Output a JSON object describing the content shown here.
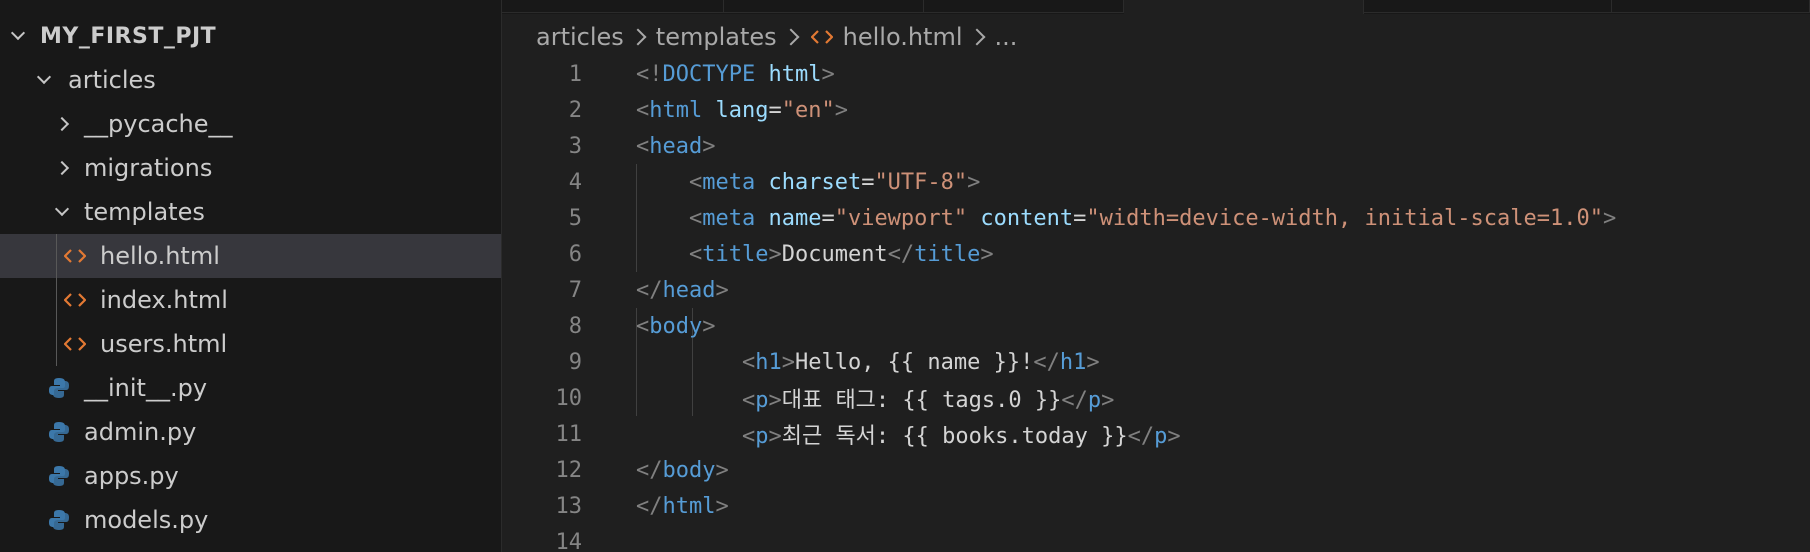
{
  "explorer": {
    "root": "MY_FIRST_PJT",
    "items": [
      {
        "label": "articles",
        "icon": "chevron-down-icon"
      },
      {
        "label": "__pycache__",
        "icon": "chevron-right-icon"
      },
      {
        "label": "migrations",
        "icon": "chevron-right-icon"
      },
      {
        "label": "templates",
        "icon": "chevron-down-icon"
      },
      {
        "label": "hello.html",
        "icon": "html-file-icon",
        "selected": true
      },
      {
        "label": "index.html",
        "icon": "html-file-icon"
      },
      {
        "label": "users.html",
        "icon": "html-file-icon"
      },
      {
        "label": "__init__.py",
        "icon": "python-file-icon"
      },
      {
        "label": "admin.py",
        "icon": "python-file-icon"
      },
      {
        "label": "apps.py",
        "icon": "python-file-icon"
      },
      {
        "label": "models.py",
        "icon": "python-file-icon"
      }
    ]
  },
  "breadcrumb": {
    "items": [
      "articles",
      "templates",
      "hello.html",
      "..."
    ]
  },
  "colors": {
    "html_icon": "#e37933",
    "python_icon_blue": "#3c78aa",
    "python_icon_yellow": "#ffd43b",
    "tag": "#569cd6",
    "attr": "#9cdcfe",
    "string": "#ce9178",
    "punctuation": "#808080",
    "text": "#d4d4d4"
  },
  "editor": {
    "lines": [
      {
        "num": "1",
        "tokens": [
          [
            "punc",
            "<!"
          ],
          [
            "tag",
            "DOCTYPE"
          ],
          [
            "text",
            " "
          ],
          [
            "attr",
            "html"
          ],
          [
            "punc",
            ">"
          ]
        ]
      },
      {
        "num": "2",
        "tokens": [
          [
            "punc",
            "<"
          ],
          [
            "tag",
            "html"
          ],
          [
            "text",
            " "
          ],
          [
            "attr",
            "lang"
          ],
          [
            "text",
            "="
          ],
          [
            "str",
            "\"en\""
          ],
          [
            "punc",
            ">"
          ]
        ]
      },
      {
        "num": "3",
        "tokens": [
          [
            "punc",
            "<"
          ],
          [
            "tag",
            "head"
          ],
          [
            "punc",
            ">"
          ]
        ]
      },
      {
        "num": "4",
        "tokens": [
          [
            "text",
            "    "
          ],
          [
            "punc",
            "<"
          ],
          [
            "tag",
            "meta"
          ],
          [
            "text",
            " "
          ],
          [
            "attr",
            "charset"
          ],
          [
            "text",
            "="
          ],
          [
            "str",
            "\"UTF-8\""
          ],
          [
            "punc",
            ">"
          ]
        ]
      },
      {
        "num": "5",
        "tokens": [
          [
            "text",
            "    "
          ],
          [
            "punc",
            "<"
          ],
          [
            "tag",
            "meta"
          ],
          [
            "text",
            " "
          ],
          [
            "attr",
            "name"
          ],
          [
            "text",
            "="
          ],
          [
            "str",
            "\"viewport\""
          ],
          [
            "text",
            " "
          ],
          [
            "attr",
            "content"
          ],
          [
            "text",
            "="
          ],
          [
            "str",
            "\"width=device-width, initial-scale=1.0\""
          ],
          [
            "punc",
            ">"
          ]
        ]
      },
      {
        "num": "6",
        "tokens": [
          [
            "text",
            "    "
          ],
          [
            "punc",
            "<"
          ],
          [
            "tag",
            "title"
          ],
          [
            "punc",
            ">"
          ],
          [
            "text",
            "Document"
          ],
          [
            "punc",
            "</"
          ],
          [
            "tag",
            "title"
          ],
          [
            "punc",
            ">"
          ]
        ]
      },
      {
        "num": "7",
        "tokens": [
          [
            "punc",
            "</"
          ],
          [
            "tag",
            "head"
          ],
          [
            "punc",
            ">"
          ]
        ]
      },
      {
        "num": "8",
        "tokens": [
          [
            "punc",
            "<"
          ],
          [
            "tag",
            "body"
          ],
          [
            "punc",
            ">"
          ]
        ]
      },
      {
        "num": "9",
        "tokens": [
          [
            "text",
            "        "
          ],
          [
            "punc",
            "<"
          ],
          [
            "tag",
            "h1"
          ],
          [
            "punc",
            ">"
          ],
          [
            "text",
            "Hello, {{ name }}!"
          ],
          [
            "punc",
            "</"
          ],
          [
            "tag",
            "h1"
          ],
          [
            "punc",
            ">"
          ]
        ]
      },
      {
        "num": "10",
        "tokens": [
          [
            "text",
            "        "
          ],
          [
            "punc",
            "<"
          ],
          [
            "tag",
            "p"
          ],
          [
            "punc",
            ">"
          ],
          [
            "text",
            "대표 태그: {{ tags.0 }}"
          ],
          [
            "punc",
            "</"
          ],
          [
            "tag",
            "p"
          ],
          [
            "punc",
            ">"
          ]
        ]
      },
      {
        "num": "11",
        "tokens": [
          [
            "text",
            "        "
          ],
          [
            "punc",
            "<"
          ],
          [
            "tag",
            "p"
          ],
          [
            "punc",
            ">"
          ],
          [
            "text",
            "최근 독서: {{ books.today }}"
          ],
          [
            "punc",
            "</"
          ],
          [
            "tag",
            "p"
          ],
          [
            "punc",
            ">"
          ]
        ]
      },
      {
        "num": "12",
        "tokens": [
          [
            "punc",
            "</"
          ],
          [
            "tag",
            "body"
          ],
          [
            "punc",
            ">"
          ]
        ]
      },
      {
        "num": "13",
        "tokens": [
          [
            "punc",
            "</"
          ],
          [
            "tag",
            "html"
          ],
          [
            "punc",
            ">"
          ]
        ]
      },
      {
        "num": "14",
        "tokens": []
      }
    ]
  }
}
